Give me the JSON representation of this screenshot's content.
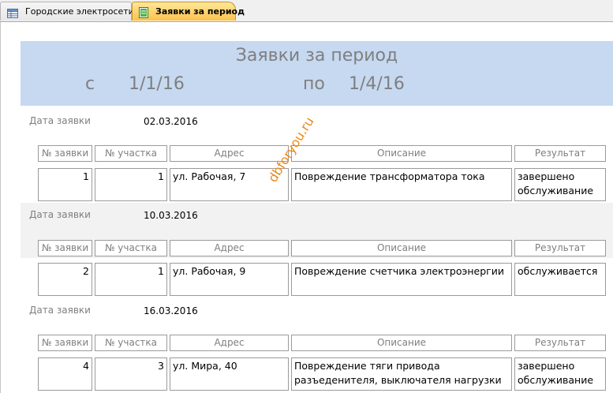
{
  "tabs": [
    {
      "label": "Городские электросети",
      "icon": "table-icon",
      "active": false
    },
    {
      "label": "Заявки за период",
      "icon": "report-icon",
      "active": true
    }
  ],
  "report": {
    "title": "Заявки за период",
    "from_label": "с",
    "from_value": "1/1/16",
    "to_label": "по",
    "to_value": "1/4/16",
    "group_label": "Дата заявки",
    "columns": [
      "№ заявки",
      "№ участка",
      "Адрес",
      "Описание",
      "Результат"
    ],
    "groups": [
      {
        "date": "02.03.2016",
        "rows": [
          {
            "id": "1",
            "section": "1",
            "address": "ул. Рабочая, 7",
            "description": "Повреждение трансформатора тока",
            "result": "завершено обслуживание"
          }
        ]
      },
      {
        "date": "10.03.2016",
        "rows": [
          {
            "id": "2",
            "section": "1",
            "address": "ул. Рабочая, 9",
            "description": "Повреждение счетчика электроэнергии",
            "result": "обслуживается"
          }
        ]
      },
      {
        "date": "16.03.2016",
        "rows": [
          {
            "id": "4",
            "section": "3",
            "address": "ул. Мира, 40",
            "description": "Повреждение тяги привода разъеденителя, выключателя нагрузки",
            "result": "завершено обслуживание"
          }
        ]
      }
    ]
  },
  "watermark": "dbforyou.ru",
  "colors": {
    "header_bg": "#c6d9f1",
    "alt_band": "#f2f2f2",
    "active_tab": "#fcc24c",
    "watermark": "#e9891b"
  }
}
